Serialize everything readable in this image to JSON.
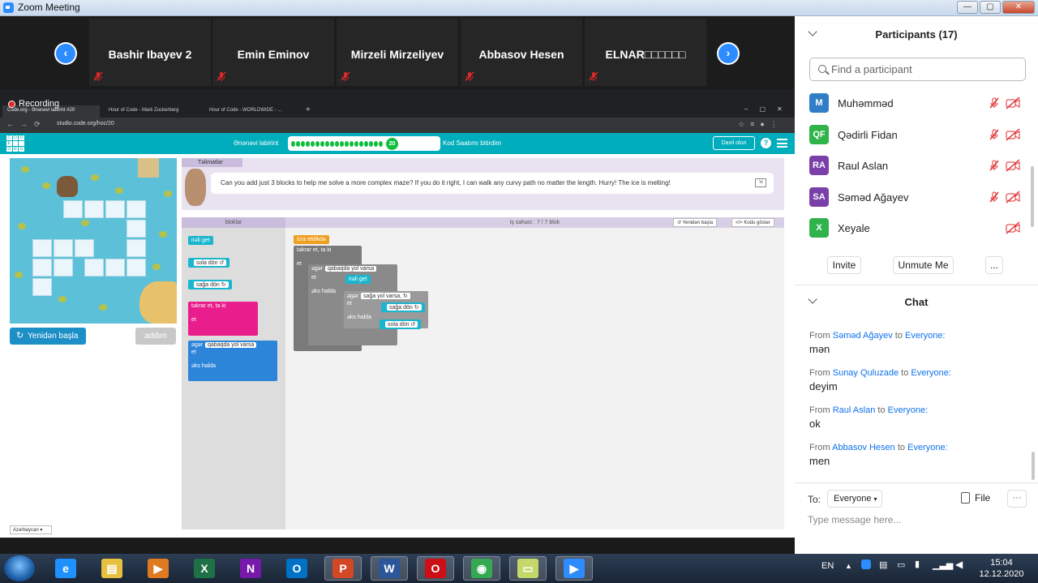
{
  "window": {
    "title": "Zoom Meeting"
  },
  "video_strip": {
    "prev_icon": "chevron-left-icon",
    "next_icon": "chevron-right-icon",
    "tiles": [
      {
        "name": "Bashir Ibayev 2"
      },
      {
        "name": "Emin Eminov"
      },
      {
        "name": "Mirzeli Mirzeliyev"
      },
      {
        "name": "Abbasov Hesen"
      },
      {
        "name": "ELNAR□□□□□□"
      }
    ]
  },
  "share": {
    "recording_label": "Recording",
    "browser": {
      "tabs": [
        {
          "label": "Code.org - Ənənəvi labirint #20"
        },
        {
          "label": "Hour of Code - Mark Zuckerberg"
        },
        {
          "label": "Hour of Code - WORLDWIDE - ..."
        }
      ],
      "url": "studio.code.org/hoc/20"
    },
    "codeorg": {
      "level_title": "Ənənəvi labirint",
      "level_number": "20",
      "progress_done_dots": 19,
      "finish_text": "Kod Saatımı bitirdim",
      "signin_label": "Daxil olun",
      "reset_label": "Yenidən başla",
      "step_label": "addım",
      "instructions_label": "Təlimatlar",
      "instruction_text": "Can you add just 3 blocks to help me solve a more complex maze? If you do it right, I can walk any curvy path no matter the length. Hurry! The ice is melting!",
      "toolbox_label": "bloklar",
      "workspace_label": "iş sahəsi : 7 / 7 blok",
      "ws_reset_label": "Yenidən başla",
      "ws_show_code_label": "Kodu göstər",
      "language": "Azərbaycan",
      "toolbox_blocks": {
        "forward": "irəli get",
        "left": "sola dön ↺",
        "right": "sağa dön ↻",
        "repeat": "təkrar et, ta ki",
        "do": "et",
        "if": "əgər",
        "if_cond": "qabaqda yol varsa",
        "else": "əks halda"
      },
      "workspace_blocks": {
        "when_run": "icra etdikdə",
        "repeat": "təkrar et, ta ki",
        "do": "et",
        "if1": "əgər",
        "if1_cond": "qabaqda yol varsa",
        "do1": "et",
        "forward": "irəli get",
        "else1": "əks halda",
        "if2": "əgər",
        "if2_cond": "sağa yol varsa, ↻",
        "do2": "et",
        "right": "sağa dön ↻",
        "else2": "əks halda",
        "left": "sola dön ↺"
      }
    }
  },
  "participants": {
    "header": "Participants (17)",
    "search_placeholder": "Find a participant",
    "list": [
      {
        "initials": "M",
        "name": "Muhəmməd",
        "color": "#2f7ec7",
        "mic_muted": true,
        "video_off": true
      },
      {
        "initials": "QF",
        "name": "Qədirli Fidan",
        "color": "#2fb34a",
        "mic_muted": true,
        "video_off": true
      },
      {
        "initials": "RA",
        "name": "Raul Aslan",
        "color": "#7a3fa8",
        "mic_muted": true,
        "video_off": true
      },
      {
        "initials": "SA",
        "name": "Səməd Ağayev",
        "color": "#7a3fa8",
        "mic_muted": true,
        "video_off": true
      },
      {
        "initials": "X",
        "name": "Xeyale",
        "color": "#2fb34a",
        "mic_muted": false,
        "video_off": true
      }
    ],
    "invite_label": "Invite",
    "unmute_label": "Unmute Me",
    "more_label": "..."
  },
  "chat": {
    "header": "Chat",
    "messages": [
      {
        "from_label": "From",
        "sender": "Səməd Ağayev",
        "to_label": "to",
        "recipient": "Everyone:",
        "text": "mən"
      },
      {
        "from_label": "From",
        "sender": "Sunay Quluzade",
        "to_label": "to",
        "recipient": "Everyone:",
        "text": "deyim"
      },
      {
        "from_label": "From",
        "sender": "Raul Aslan",
        "to_label": "to",
        "recipient": "Everyone:",
        "text": "ok"
      },
      {
        "from_label": "From",
        "sender": "Abbasov Hesen",
        "to_label": "to",
        "recipient": "Everyone:",
        "text": "men"
      }
    ],
    "to_label": "To:",
    "to_value": "Everyone",
    "file_label": "File",
    "more_label": "···",
    "placeholder": "Type message here..."
  },
  "taskbar": {
    "apps": [
      {
        "name": "internet-explorer-icon",
        "glyph": "e",
        "color": "#1e90ff"
      },
      {
        "name": "file-explorer-icon",
        "glyph": "▤",
        "color": "#e8c040"
      },
      {
        "name": "media-player-icon",
        "glyph": "▶",
        "color": "#e07a20"
      },
      {
        "name": "excel-icon",
        "glyph": "X",
        "color": "#1e7145"
      },
      {
        "name": "onenote-icon",
        "glyph": "N",
        "color": "#7719aa"
      },
      {
        "name": "outlook-icon",
        "glyph": "O",
        "color": "#0072c6"
      },
      {
        "name": "powerpoint-icon",
        "glyph": "P",
        "color": "#d24726"
      },
      {
        "name": "word-icon",
        "glyph": "W",
        "color": "#2b579a"
      },
      {
        "name": "opera-icon",
        "glyph": "O",
        "color": "#cc0f16"
      },
      {
        "name": "chrome-icon",
        "glyph": "◉",
        "color": "#34a853"
      },
      {
        "name": "sticky-notes-icon",
        "glyph": "▭",
        "color": "#c4d86a"
      },
      {
        "name": "zoom-icon",
        "glyph": "▶",
        "color": "#2d8cff"
      }
    ],
    "language": "EN",
    "time": "15:04",
    "date": "12.12.2020"
  }
}
